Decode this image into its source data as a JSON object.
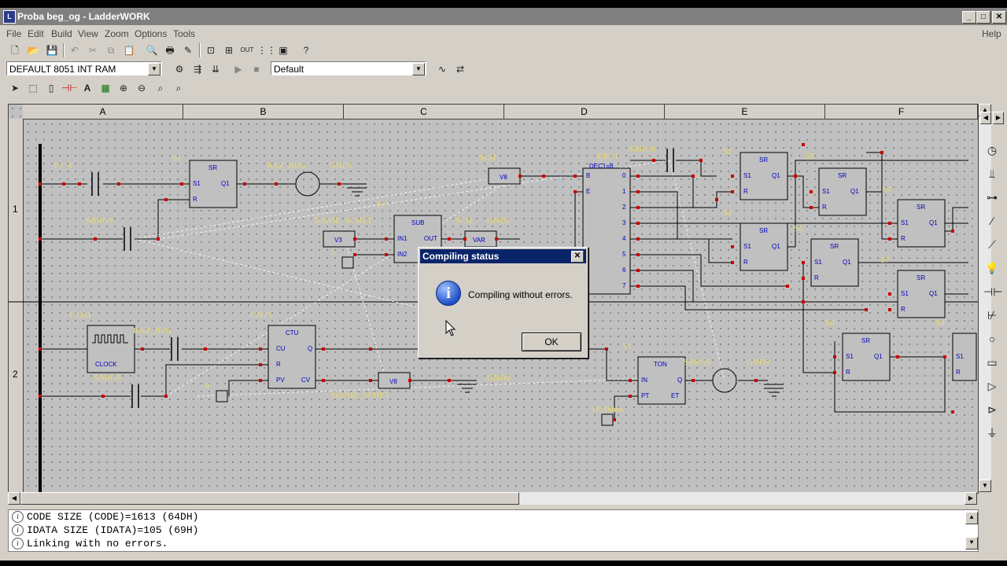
{
  "window": {
    "title": "Proba beg_og - LadderWORK",
    "app_icon": "ladderwork-app-icon"
  },
  "title_buttons": {
    "minimize": "_",
    "maximize": "□",
    "close": "✕"
  },
  "menu": [
    "File",
    "Edit",
    "Build",
    "View",
    "Zoom",
    "Options",
    "Tools"
  ],
  "menu_help": "Help",
  "toolbar1_icons": [
    "new-file-icon",
    "open-folder-icon",
    "save-icon",
    "undo-icon",
    "cut-icon",
    "copy-icon",
    "paste-icon",
    "print-preview-icon",
    "print-icon",
    "edit-pencil-icon",
    "select-mode-icon",
    "network-icon",
    "output-icon",
    "grid-icon",
    "frame-icon",
    "help-icon"
  ],
  "target_combo": {
    "value": "DEFAULT 8051 INT RAM"
  },
  "profile_combo": {
    "value": "Default"
  },
  "toolbar3_icons": [
    "pointer-icon",
    "rect-select-icon",
    "box-icon",
    "contact-icon",
    "text-icon",
    "image-icon",
    "zoom-in-icon",
    "zoom-out-icon",
    "zoom-fit-icon",
    "zoom-100-icon"
  ],
  "columns": [
    "A",
    "B",
    "C",
    "D",
    "E",
    "F"
  ],
  "rows": [
    "1",
    "2"
  ],
  "labels": {
    "p1_4": "P1_4",
    "s1": "S1",
    "raz_beg": "RAZ_BEG",
    "gnd1": "GND1",
    "sch": "SCH",
    "dec1": "DEC1",
    "sbros_top": "SBROS",
    "s2": "S2",
    "s3": "S3",
    "sbros_a": "SBROS",
    "p1": "P1",
    "danie_schet": "DANIE_SCHET",
    "sch2": "SCH",
    "gnd2": "GND2",
    "s5": "S5",
    "s6": "S6",
    "s4": "S4",
    "s7": "S7",
    "clk1": "CLK1",
    "raz_beg2": "RAZ_BEG",
    "cnt1": "CNT1",
    "t1": "T1",
    "sbros_t": "SBROS",
    "gnd3": "GND3",
    "s8": "S8",
    "s9": "S9",
    "sbros_b": "SBROS",
    "eight": "8",
    "one": "1",
    "danie_schet2": "DANIE_SCHET",
    "gnd4": "GND4",
    "t200": "T#200ms"
  },
  "blocks": {
    "sr": "SR",
    "s1pin": "S1",
    "q1pin": "Q1",
    "rpin": "R",
    "v8": "V8",
    "v3": "V3",
    "var": "VAR",
    "sub": "SUB",
    "in1": "IN1",
    "in2": "IN2",
    "out": "OUT",
    "dec": "DEC1=8",
    "dec_b": "B",
    "dec_e": "E",
    "dec_outs": [
      "0",
      "1",
      "2",
      "3",
      "4",
      "5",
      "6",
      "7"
    ],
    "ctu": "CTU",
    "cu": "CU",
    "q": "Q",
    "pv": "PV",
    "cv": "CV",
    "clock": "CLOCK",
    "ton": "TON",
    "tin": "IN",
    "pt": "PT",
    "et": "ET"
  },
  "output_lines": [
    "CODE SIZE (CODE)=1613 (64DH)",
    "IDATA SIZE (IDATA)=105 (69H)",
    "Linking with no errors."
  ],
  "dialog": {
    "title": "Compiling status",
    "message": "Compiling without errors.",
    "ok": "OK",
    "close": "✕",
    "icon_glyph": "i"
  },
  "palette_icons": [
    "clock-icon",
    "contact-no-icon",
    "coil-icon",
    "wire-icon",
    "diagonal-icon",
    "bulb-icon",
    "parallel-contact-icon",
    "contact-nc-icon",
    "circle-coil-icon",
    "box-icon",
    "arrow-in-icon",
    "arrow-out-icon",
    "ground-icon"
  ],
  "colors": {
    "accent_title": "#0a246a",
    "schematic_label": "#e8d870",
    "block_text": "#0000c0",
    "node": "#cc0000",
    "wire": "#000000",
    "link": "#ffffff"
  }
}
